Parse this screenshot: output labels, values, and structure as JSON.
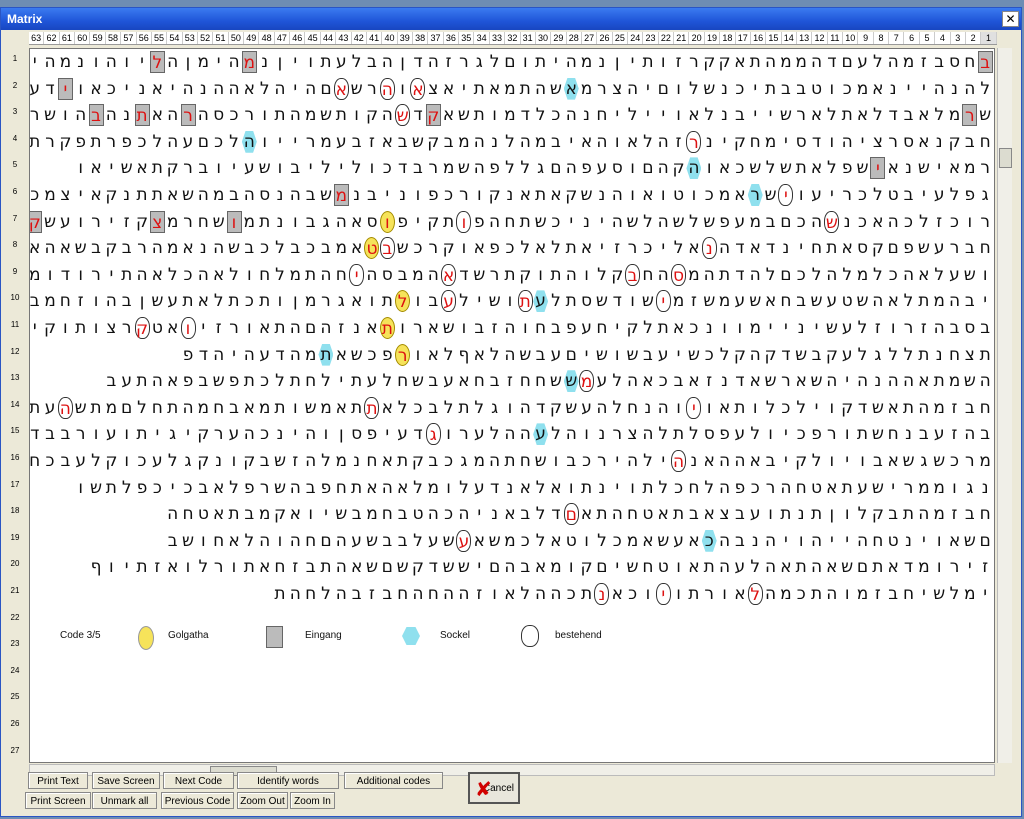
{
  "window": {
    "title": "Matrix",
    "close_glyph": "✕"
  },
  "ruler": {
    "columns": [
      "63",
      "62",
      "61",
      "60",
      "59",
      "58",
      "57",
      "56",
      "55",
      "54",
      "53",
      "52",
      "51",
      "50",
      "49",
      "48",
      "47",
      "46",
      "45",
      "44",
      "43",
      "42",
      "41",
      "40",
      "39",
      "38",
      "37",
      "36",
      "35",
      "34",
      "33",
      "32",
      "31",
      "30",
      "29",
      "28",
      "27",
      "26",
      "25",
      "24",
      "23",
      "22",
      "21",
      "20",
      "19",
      "18",
      "17",
      "16",
      "15",
      "14",
      "13",
      "12",
      "11",
      "10",
      "9",
      "8",
      "7",
      "6",
      "5",
      "4",
      "3",
      "2",
      "1"
    ],
    "active_column": "1"
  },
  "row_numbers": [
    "1",
    "2",
    "3",
    "4",
    "5",
    "6",
    "7",
    "8",
    "9",
    "10",
    "11",
    "12",
    "13",
    "14",
    "15",
    "16",
    "17",
    "18",
    "19",
    "20",
    "21",
    "22",
    "23",
    "24",
    "25",
    "26",
    "27"
  ],
  "grid_rows": [
    "בחסבזמהלעםדהממהתאקקרזותיןנמהיתוםלגרזהדןהבלעתויןנמהימןהליוהונמהיוןנבזא",
    "להנהיינאמכוטבבתיכנשלוםיהצרמאשהתמאתיאצאוהרשאםהיהלאההנהיאניכאוידעדתנויה",
    "שרמלאבדלאתלארשייבנלאוייליחנהכלדמותשאקדשהקותשמהתורכסהרהאתנהבהושרדקיםהבועגנה",
    "חבקנאסרציהודסימחקינרזהלאוהאיבמהלנהמבקשבאזבעמרייוהלכםעהלכפרתפקרתיי",
    "רמאישנאישפלאתשלשכאוהקהםוסעפהםגללפהשמרבדכוליליבושעיוברקתאשיאו",
    "גפלעיבטלכריעוישראמכוטואוהנשקאתאנקורכפוניבנמשבהנסהבמהשאתתנקאיצמכיפה",
    "רוכזלכהאכנשהכםבמעפשלשהלשהיניכשתחהפותקיפוסאהגבונתמושחרמצקזירועשקבש",
    "חברעשפםקסאתחינדאדהנאליכרזיאתלאלכפאוקרכשבטאמבכבלכבשהנאמהרבקבשאהאבה",
    "ושעלאהכלמלהלכםלהדתהמסהחבקלוהתוקתרשדאהמבסהיחהתמלחולאהכלאהתירודומלואושעיל",
    "יבהמתלאהשטעשבחאשעמשזמישודשסתלעתושילעבולתואגרמןותכתלאתעשןבהוזחמבר",
    "בסבהזרוזלעשיניימוונכאתלקיחעפבחוהזבושארותאנזהםהתאורזיואטקרצותוקיי",
    "תצחנתללגלעקבשדקהקלכשיעבשושיםעבשהלאףלאורפכשאתמהדעהיהדפ",
    "השמתאההנהיהשארשאדנזאבכאהלעמששחחזבחאעבשחלעתילחתלכתפשבפאהתעב",
    "חבזמהתאשדקוילכלותאויוהנחלהעשקדהוגלתלבכלאתתאמשותמאבחמהתחלםמתשהעתשדקוקבור",
    "בהזעבנחשתורפכיולעפסלתלהצרנוהלעההלערוגדעיפסןוהינכהערקיגיתועורבבדגכי",
    "מרכשגשאבויולקיבאההאנהילהירכבושחתהמגכבקתאחנמלהזשבקונקגלעכוקלעבכחת",
    "נגוממרישעתאטחהרכפהלחכלתוינתואלאנדעלומלאהאתחפבהשרפלאבכיכפלתשו",
    "חבזמהתבקלוןתנתועבצאבתאטחהתאםדלבאניהכהטבחמבשיואקמבתאטחה",
    "םשאוינטחהייהויהנבהכאעשאמכלוטאלכמשאעשעלבבשעהםחהוהלאחושב",
    "זירומדאתםשאהתאהלעהתאוטחשיםקומאבהםיששדקשםשאהתבזחאתורלואזתיוף",
    "ימלשיחבזמוהתכמהלאורתויוכאנתכההלאוזההחהחבזבהלחהת"
  ],
  "highlights": {
    "gray": [
      [
        1,
        0
      ],
      [
        1,
        48
      ],
      [
        1,
        54
      ],
      [
        2,
        60
      ],
      [
        3,
        1
      ],
      [
        3,
        36
      ],
      [
        3,
        52
      ],
      [
        3,
        55
      ],
      [
        3,
        58
      ],
      [
        5,
        7
      ],
      [
        6,
        42
      ],
      [
        7,
        49
      ],
      [
        7,
        54
      ],
      [
        7,
        62
      ]
    ],
    "oval": [
      [
        2,
        37
      ],
      [
        2,
        39
      ],
      [
        2,
        42
      ],
      [
        3,
        38
      ],
      [
        4,
        19
      ],
      [
        6,
        13
      ],
      [
        7,
        10
      ],
      [
        7,
        34
      ],
      [
        8,
        18
      ],
      [
        8,
        39
      ],
      [
        9,
        20
      ],
      [
        9,
        23
      ],
      [
        9,
        35
      ],
      [
        9,
        41
      ],
      [
        10,
        21
      ],
      [
        10,
        30
      ],
      [
        10,
        35
      ],
      [
        11,
        52
      ],
      [
        11,
        55
      ],
      [
        12,
        62
      ],
      [
        13,
        26
      ],
      [
        14,
        19
      ],
      [
        14,
        40
      ],
      [
        14,
        60
      ],
      [
        15,
        36
      ],
      [
        16,
        20
      ],
      [
        18,
        27
      ],
      [
        19,
        34
      ],
      [
        21,
        15
      ],
      [
        21,
        21
      ],
      [
        21,
        25
      ]
    ],
    "yellow": [
      [
        7,
        39
      ],
      [
        8,
        40
      ],
      [
        10,
        38
      ],
      [
        11,
        39
      ],
      [
        12,
        38
      ]
    ],
    "cyan": [
      [
        2,
        27
      ],
      [
        4,
        48
      ],
      [
        5,
        19
      ],
      [
        6,
        15
      ],
      [
        10,
        29
      ],
      [
        12,
        43
      ],
      [
        13,
        27
      ],
      [
        15,
        29
      ],
      [
        19,
        18
      ]
    ]
  },
  "legend": {
    "code": "Code 3/5",
    "items": [
      {
        "label": "Golgatha",
        "color": "#f6e35a"
      },
      {
        "label": "Eingang",
        "color": "#bbbbbb"
      },
      {
        "label": "Sockel",
        "color": "#8fe0ee"
      },
      {
        "label": "bestehend",
        "color": "#ffffff"
      }
    ]
  },
  "buttons": {
    "print_text": "Print Text",
    "save_screen": "Save Screen",
    "next_code": "Next Code",
    "identify_words": "Identify words",
    "additional_codes": "Additional codes",
    "print_screen": "Print Screen",
    "unmark_all": "Unmark all",
    "previous_code": "Previous Code",
    "zoom_out": "Zoom Out",
    "zoom_in": "Zoom In",
    "cancel": "Cancel"
  },
  "icons": {
    "cancel": "red-x-icon",
    "close": "close-icon"
  }
}
